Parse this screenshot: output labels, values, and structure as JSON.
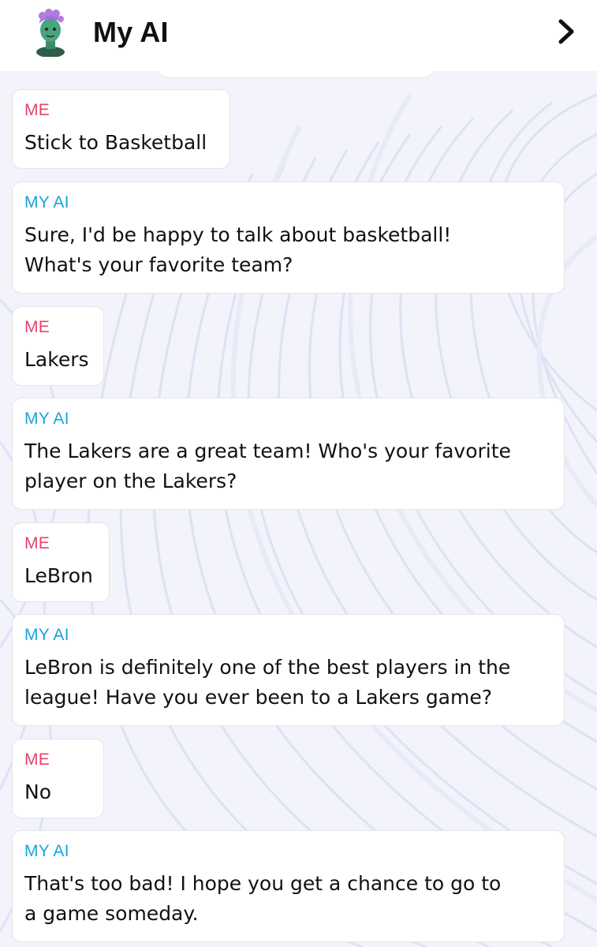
{
  "header": {
    "title": "My AI",
    "chevron_icon": "chevron-right-icon",
    "avatar_icon": "bitmoji-avatar-icon"
  },
  "colors": {
    "me_label": "#e8426a",
    "ai_label": "#1aa3dd"
  },
  "messages": [
    {
      "sender": "ME",
      "text": "Stick to Basketball"
    },
    {
      "sender": "MY AI",
      "text": "Sure, I'd be happy to talk about basketball!\nWhat's your favorite team?"
    },
    {
      "sender": "ME",
      "text": "Lakers"
    },
    {
      "sender": "MY AI",
      "text": "The Lakers are a great team! Who's your favorite\nplayer on the Lakers?"
    },
    {
      "sender": "ME",
      "text": "LeBron"
    },
    {
      "sender": "MY AI",
      "text": "LeBron is definitely one of the best players in the\nleague! Have you ever been to a Lakers game?"
    },
    {
      "sender": "ME",
      "text": "No"
    },
    {
      "sender": "MY AI",
      "text": "That's too bad! I hope you get a chance to go to\na game someday."
    }
  ]
}
